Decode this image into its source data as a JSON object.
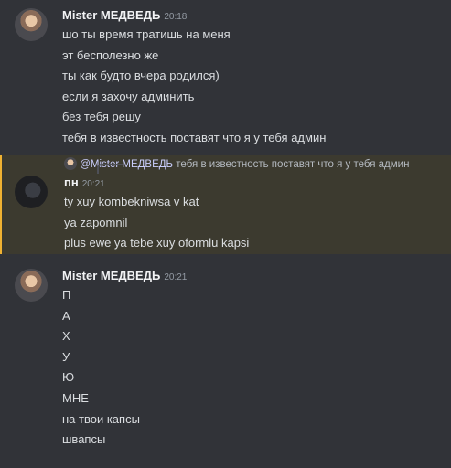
{
  "group1": {
    "author": "Mister МЕДВЕДЬ",
    "timestamp": "20:18",
    "lines": [
      "шо ты время тратишь на меня",
      "эт бесполезно же",
      "ты как будто вчера родился)",
      "если я захочу админить",
      "без тебя решу",
      "тебя в известность поставят что я у тебя админ"
    ]
  },
  "group2": {
    "reply": {
      "mention": "@Mister МЕДВЕДЬ",
      "text": "тебя в известность поставят что я у тебя админ"
    },
    "author": "пн",
    "timestamp": "20:21",
    "lines": [
      "ty xuy kombekniwsa v kat",
      "ya zapomnil",
      "plus ewe ya tebe xuy oformlu kapsi"
    ]
  },
  "group3": {
    "author": "Mister МЕДВЕДЬ",
    "timestamp": "20:21",
    "lines": [
      "П",
      "А",
      "Х",
      "У",
      "Ю",
      "МНЕ",
      "на твои капсы",
      "швапсы"
    ]
  }
}
